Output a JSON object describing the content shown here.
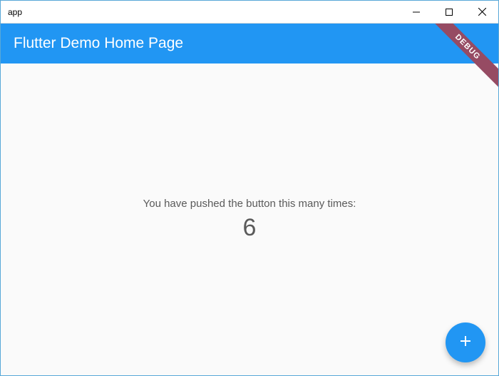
{
  "window": {
    "title": "app"
  },
  "appbar": {
    "title": "Flutter Demo Home Page"
  },
  "body": {
    "message": "You have pushed the button this many times:",
    "counter": "6"
  },
  "debug": {
    "label": "DEBUG"
  },
  "colors": {
    "primary": "#2196f3",
    "background": "#fafafa",
    "debugBanner": "#964b63"
  }
}
